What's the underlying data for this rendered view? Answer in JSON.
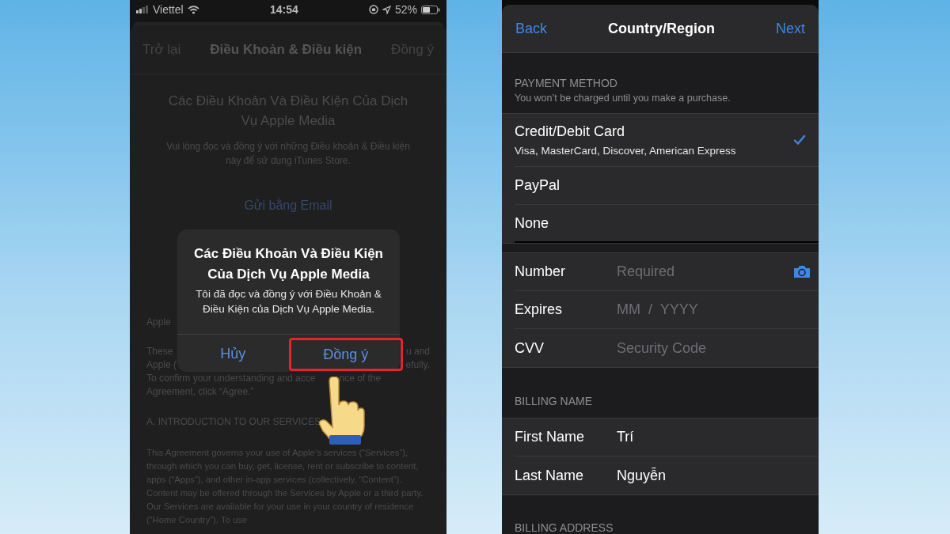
{
  "left_screen": {
    "status_bar": {
      "carrier": "Viettel",
      "time": "14:54",
      "battery": "52%"
    },
    "nav": {
      "back": "Trở lại",
      "title": "Điều Khoản & Điều kiện",
      "action": "Đồng ý"
    },
    "heading": "Các Điều Khoản Và Điều Kiện Của Dịch Vụ Apple Media",
    "intro": "Vui lòng đọc và đồng ý với những Điều khoản & Điều kiện này để sử dụng iTunes Store.",
    "email_link": "Gửi bằng Email",
    "legal_lines": [
      {
        "left": "Apple",
        "kind": "edges"
      },
      {
        "left": "These",
        "right": "u and",
        "kind": "edges"
      },
      {
        "left": "Apple (",
        "right": "efully.",
        "kind": "edges"
      },
      {
        "left": "To confirm your understanding and acce",
        "right": "nce of the",
        "kind": "split"
      },
      {
        "left": "Agreement, click “Agree.”",
        "kind": "edges"
      }
    ],
    "section_heading": "A. INTRODUCTION TO OUR SERVICES",
    "section_body": "This Agreement governs your use of Apple’s services (“Services”), through which you can buy, get, license, rent or subscribe to content, apps (“Apps”), and other in-app services (collectively, “Content”). Content may be offered through the Services by Apple or a third party. Our Services are available for your use in your country of residence (“Home Country”). To use",
    "alert": {
      "title": "Các Điều Khoản Và Điều Kiện Của Dịch Vụ Apple Media",
      "message": "Tôi đã đọc và đồng ý với Điều Khoản & Điều Kiện của Dịch Vụ Apple Media.",
      "buttons": [
        {
          "label": "Hủy",
          "highlighted": false
        },
        {
          "label": "Đồng ý",
          "highlighted": true
        }
      ]
    }
  },
  "right_screen": {
    "nav": {
      "back": "Back",
      "title": "Country/Region",
      "next": "Next"
    },
    "payment": {
      "header": "PAYMENT METHOD",
      "note": "You won’t be charged until you make a purchase.",
      "options": [
        {
          "label": "Credit/Debit Card",
          "detail": "Visa, MasterCard, Discover, American Express",
          "selected": true
        },
        {
          "label": "PayPal",
          "selected": false
        },
        {
          "label": "None",
          "selected": false
        }
      ]
    },
    "card_fields": [
      {
        "label": "Number",
        "placeholder": "Required",
        "kind": "camera"
      },
      {
        "label": "Expires",
        "placeholder": "MM  /  YYYY",
        "kind": "plain"
      },
      {
        "label": "CVV",
        "placeholder": "Security Code",
        "kind": "plain"
      }
    ],
    "billing_name": {
      "header": "BILLING NAME",
      "fields": [
        {
          "label": "First Name",
          "value": "Trí"
        },
        {
          "label": "Last Name",
          "value": "Nguyễn"
        }
      ]
    },
    "billing_address": {
      "header": "BILLING ADDRESS"
    }
  }
}
